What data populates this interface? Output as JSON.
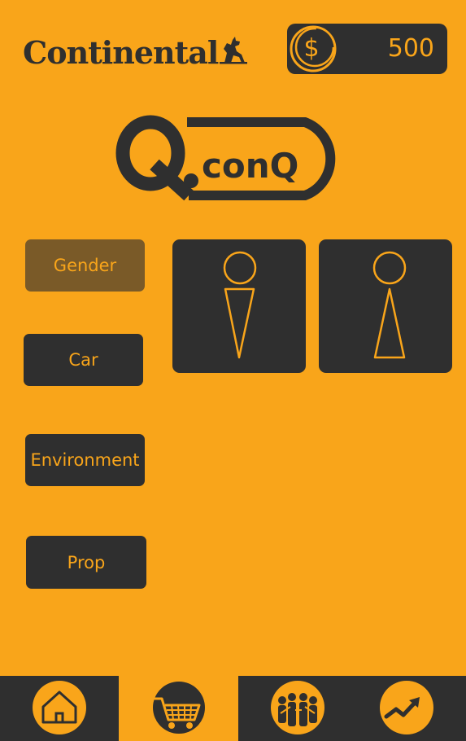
{
  "header": {
    "brand": {
      "name": "Continental",
      "logo_icon": "horse-icon"
    },
    "coins": {
      "icon": "dollar-coin-icon",
      "value": "500"
    },
    "app_logo": {
      "text": "Q.conQ"
    }
  },
  "categories": [
    {
      "label": "Gender",
      "active": true
    },
    {
      "label": "Car",
      "active": false
    },
    {
      "label": "Environment",
      "active": false
    },
    {
      "label": "Prop",
      "active": false
    }
  ],
  "gender_options": [
    {
      "icon": "male-figure-icon"
    },
    {
      "icon": "female-figure-icon"
    }
  ],
  "bottom_nav": {
    "items": [
      {
        "icon": "home-icon",
        "active": false
      },
      {
        "icon": "shopping-cart-icon",
        "active": true
      },
      {
        "icon": "community-icon",
        "active": false
      },
      {
        "icon": "trending-up-icon",
        "active": false
      }
    ]
  },
  "colors": {
    "background": "#F9A51A",
    "dark": "#2F2F2F",
    "active_category": "#7A5A28",
    "accent": "#F9A51A"
  }
}
